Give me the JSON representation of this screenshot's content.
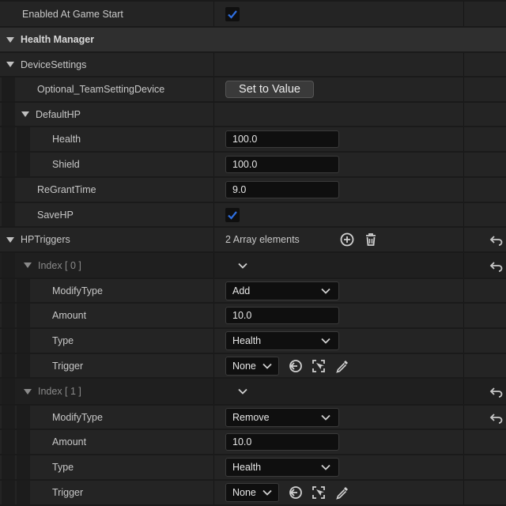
{
  "properties": {
    "enabled_at_game_start": {
      "label": "Enabled At Game Start",
      "checked": true
    },
    "health_manager": {
      "label": "Health Manager"
    },
    "device_settings": {
      "label": "DeviceSettings"
    },
    "optional_team_setting_device": {
      "label": "Optional_TeamSettingDevice",
      "button": "Set to Value"
    },
    "default_hp": {
      "label": "DefaultHP"
    },
    "health": {
      "label": "Health",
      "value": "100.0"
    },
    "shield": {
      "label": "Shield",
      "value": "100.0"
    },
    "regrant_time": {
      "label": "ReGrantTime",
      "value": "9.0"
    },
    "save_hp": {
      "label": "SaveHP",
      "checked": true
    },
    "hp_triggers": {
      "label": "HPTriggers",
      "count_text": "2 Array elements"
    },
    "index0": {
      "label": "Index [ 0 ]",
      "modify_type_label": "ModifyType",
      "modify_type_value": "Add",
      "amount_label": "Amount",
      "amount_value": "10.0",
      "type_label": "Type",
      "type_value": "Health",
      "trigger_label": "Trigger",
      "trigger_value": "None"
    },
    "index1": {
      "label": "Index [ 1 ]",
      "modify_type_label": "ModifyType",
      "modify_type_value": "Remove",
      "amount_label": "Amount",
      "amount_value": "10.0",
      "type_label": "Type",
      "type_value": "Health",
      "trigger_label": "Trigger",
      "trigger_value": "None"
    }
  },
  "colors": {
    "accent": "#2f6fe0",
    "row": "#242424",
    "section": "#2f2f2f",
    "field": "#0f0f0f",
    "text": "#c8c8c8"
  },
  "icons": [
    "checkmark-icon",
    "expand-arrow-icon",
    "add-element-icon",
    "delete-icon",
    "reset-icon",
    "chevron-down-icon",
    "use-selected-icon",
    "browse-icon",
    "picker-icon"
  ]
}
